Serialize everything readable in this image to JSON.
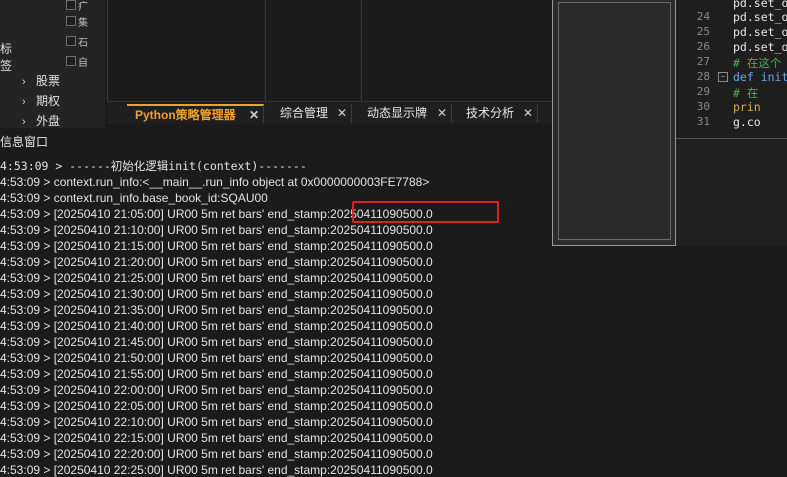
{
  "tree": {
    "left_labels": [
      "标",
      "签"
    ],
    "sub_items": [
      "疒",
      "集",
      "石",
      "自"
    ],
    "items": [
      {
        "caret": "›",
        "label": "股票"
      },
      {
        "caret": "›",
        "label": "期权"
      },
      {
        "caret": "›",
        "label": "外盘"
      }
    ]
  },
  "tabs": [
    {
      "label": "Python策略管理器",
      "close": "✕",
      "active": true
    },
    {
      "label": "综合管理",
      "close": "✕",
      "active": false
    },
    {
      "label": "动态显示牌",
      "close": "✕",
      "active": false
    },
    {
      "label": "技术分析",
      "close": "✕",
      "active": false
    }
  ],
  "editor": {
    "lines": [
      {
        "num": "",
        "code": "pd.set_o"
      },
      {
        "num": "24",
        "code": "pd.set_o"
      },
      {
        "num": "25",
        "code": "pd.set_o"
      },
      {
        "num": "26",
        "code": "pd.set_o"
      },
      {
        "num": "27",
        "code": "#  在这个"
      },
      {
        "num": "28",
        "code": "def init("
      },
      {
        "num": "29",
        "code": "    # 在"
      },
      {
        "num": "30",
        "code": "    prin"
      },
      {
        "num": "31",
        "code": "    g.co"
      }
    ],
    "fold_glyph": "−"
  },
  "log": {
    "title": "信息窗口",
    "lines": [
      "4:53:09 > ------初始化逻辑init(context)-------",
      "4:53:09 > context.run_info:<__main__.run_info object at 0x0000000003FE7788>",
      "4:53:09 > context.run_info.base_book_id:SQAU00",
      "4:53:09 > [20250410 21:05:00]  UR00 5m ret bars' end_stamp:20250411090500.0",
      "4:53:09 > [20250410 21:10:00]  UR00 5m ret bars' end_stamp:20250411090500.0",
      "4:53:09 > [20250410 21:15:00]  UR00 5m ret bars' end_stamp:20250411090500.0",
      "4:53:09 > [20250410 21:20:00]  UR00 5m ret bars' end_stamp:20250411090500.0",
      "4:53:09 > [20250410 21:25:00]  UR00 5m ret bars' end_stamp:20250411090500.0",
      "4:53:09 > [20250410 21:30:00]  UR00 5m ret bars' end_stamp:20250411090500.0",
      "4:53:09 > [20250410 21:35:00]  UR00 5m ret bars' end_stamp:20250411090500.0",
      "4:53:09 > [20250410 21:40:00]  UR00 5m ret bars' end_stamp:20250411090500.0",
      "4:53:09 > [20250410 21:45:00]  UR00 5m ret bars' end_stamp:20250411090500.0",
      "4:53:09 > [20250410 21:50:00]  UR00 5m ret bars' end_stamp:20250411090500.0",
      "4:53:09 > [20250410 21:55:00]  UR00 5m ret bars' end_stamp:20250411090500.0",
      "4:53:09 > [20250410 22:00:00]  UR00 5m ret bars' end_stamp:20250411090500.0",
      "4:53:09 > [20250410 22:05:00]  UR00 5m ret bars' end_stamp:20250411090500.0",
      "4:53:09 > [20250410 22:10:00]  UR00 5m ret bars' end_stamp:20250411090500.0",
      "4:53:09 > [20250410 22:15:00]  UR00 5m ret bars' end_stamp:20250411090500.0",
      "4:53:09 > [20250410 22:20:00]  UR00 5m ret bars' end_stamp:20250411090500.0",
      "4:53:09 > [20250410 22:25:00]  UR00 5m ret bars' end_stamp:20250411090500.0"
    ]
  }
}
